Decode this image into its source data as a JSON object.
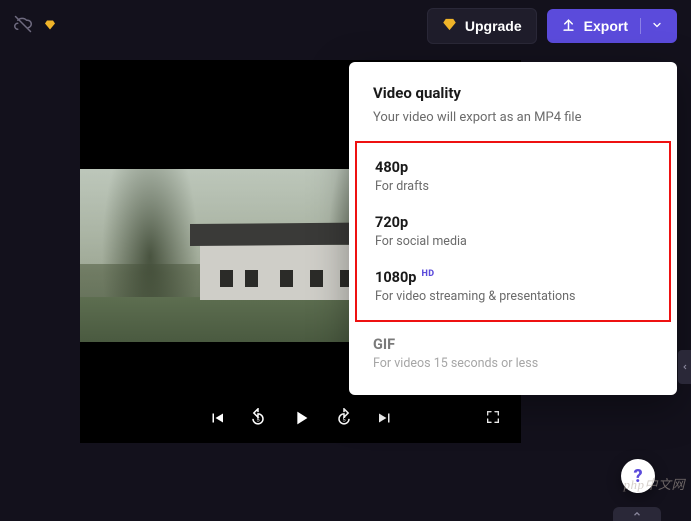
{
  "topbar": {
    "upgrade_label": "Upgrade",
    "export_label": "Export"
  },
  "dropdown": {
    "title": "Video quality",
    "subtitle": "Your video will export as an MP4 file",
    "options": [
      {
        "label": "480p",
        "sub": "For drafts",
        "hd": false
      },
      {
        "label": "720p",
        "sub": "For social media",
        "hd": false
      },
      {
        "label": "1080p",
        "sub": "For video streaming & presentations",
        "hd": true
      }
    ],
    "gif": {
      "label": "GIF",
      "sub": "For videos 15 seconds or less"
    },
    "hd_badge": "HD"
  },
  "controls": {
    "skip_back_seconds": "5",
    "skip_fwd_seconds": "5"
  },
  "help_label": "?",
  "watermark": "php中文网"
}
